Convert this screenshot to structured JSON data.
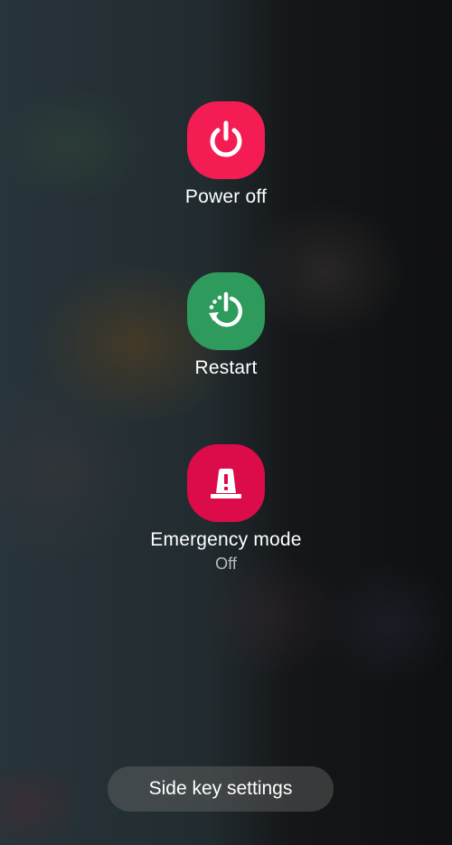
{
  "power_menu": {
    "items": [
      {
        "label": "Power off",
        "icon": "power-icon",
        "color": "#f41d53"
      },
      {
        "label": "Restart",
        "icon": "restart-icon",
        "color": "#2e9a5b"
      },
      {
        "label": "Emergency mode",
        "sublabel": "Off",
        "icon": "emergency-light-icon",
        "color": "#dc0b4a"
      }
    ]
  },
  "side_key_settings": {
    "label": "Side key settings"
  }
}
